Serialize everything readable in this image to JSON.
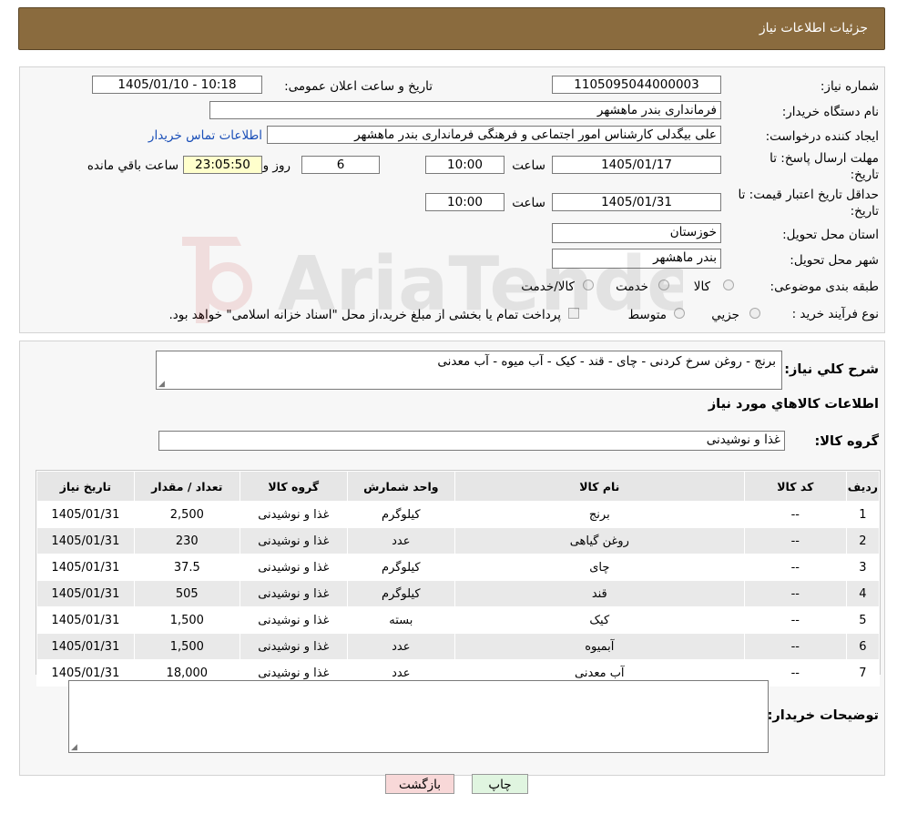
{
  "header": {
    "title": "جزئیات اطلاعات نیاز"
  },
  "form": {
    "need_number_label": "شماره نیاز:",
    "need_number": "1105095044000003",
    "announce_label": "تاریخ و ساعت اعلان عمومی:",
    "announce_value": "1405/01/10 - 10:18",
    "buyer_org_label": "نام دستگاه خریدار:",
    "buyer_org": "فرمانداری بندر ماهشهر",
    "creator_label": "ایجاد کننده درخواست:",
    "creator": "علی بیگدلی کارشناس امور اجتماعی و فرهنگی فرمانداری بندر ماهشهر",
    "contact_link": "اطلاعات تماس خریدار",
    "deadline_label_1": "مهلت ارسال پاسخ: تا",
    "deadline_label_2": "تاریخ:",
    "deadline_date": "1405/01/17",
    "time_label": "ساعت",
    "deadline_time": "10:00",
    "days_value": "6",
    "days_label": "روز و",
    "remaining_time": "23:05:50",
    "remaining_label": "ساعت باقي مانده",
    "validity_label_1": "حداقل تاریخ اعتبار قیمت: تا",
    "validity_label_2": "تاریخ:",
    "validity_date": "1405/01/31",
    "validity_time": "10:00",
    "province_label": "استان محل تحویل:",
    "province": "خوزستان",
    "city_label": "شهر محل تحویل:",
    "city": "بندر ماهشهر",
    "category_label": "طبقه بندی موضوعی:",
    "category_options": [
      "کالا",
      "خدمت",
      "کالا/خدمت"
    ],
    "process_label": "نوع فرآیند خرید :",
    "process_options": [
      "جزیي",
      "متوسط"
    ],
    "payment_note": "پرداخت تمام یا بخشی از مبلغ خرید،از محل \"اسناد خزانه اسلامی\" خواهد بود."
  },
  "details": {
    "summary_label": "شرح کلي نیاز:",
    "summary": "برنج - روغن سرخ کردنی - چای - قند - کیک - آب میوه - آب معدنی",
    "goods_info_title": "اطلاعات کالاهاي مورد نیاز",
    "goods_group_label": "گروه کالا:",
    "goods_group": "غذا و نوشیدنی",
    "buyer_notes_label": "توضیحات خریدار:"
  },
  "table": {
    "headers": [
      "ردیف",
      "کد کالا",
      "نام کالا",
      "واحد شمارش",
      "گروه کالا",
      "تعداد / مقدار",
      "تاریخ نیاز"
    ],
    "rows": [
      {
        "row": "1",
        "code": "--",
        "name": "برنج",
        "unit": "کیلوگرم",
        "group": "غذا و نوشیدنی",
        "qty": "2,500",
        "date": "1405/01/31"
      },
      {
        "row": "2",
        "code": "--",
        "name": "روغن گیاهی",
        "unit": "عدد",
        "group": "غذا و نوشیدنی",
        "qty": "230",
        "date": "1405/01/31"
      },
      {
        "row": "3",
        "code": "--",
        "name": "چای",
        "unit": "کیلوگرم",
        "group": "غذا و نوشیدنی",
        "qty": "37.5",
        "date": "1405/01/31"
      },
      {
        "row": "4",
        "code": "--",
        "name": "قند",
        "unit": "کیلوگرم",
        "group": "غذا و نوشیدنی",
        "qty": "505",
        "date": "1405/01/31"
      },
      {
        "row": "5",
        "code": "--",
        "name": "کیک",
        "unit": "بسته",
        "group": "غذا و نوشیدنی",
        "qty": "1,500",
        "date": "1405/01/31"
      },
      {
        "row": "6",
        "code": "--",
        "name": "آبمیوه",
        "unit": "عدد",
        "group": "غذا و نوشیدنی",
        "qty": "1,500",
        "date": "1405/01/31"
      },
      {
        "row": "7",
        "code": "--",
        "name": "آب معدنی",
        "unit": "عدد",
        "group": "غذا و نوشیدنی",
        "qty": "18,000",
        "date": "1405/01/31"
      }
    ]
  },
  "buttons": {
    "back": "بازگشت",
    "print": "چاپ"
  },
  "watermark": {
    "text": "AriaTender.neT"
  },
  "colors": {
    "header_bg": "#8a6b3e",
    "link": "#1a4fb8",
    "remaining_bg": "#ffffcc",
    "back_bg": "#f8d8d8",
    "print_bg": "#e0f5e0"
  }
}
